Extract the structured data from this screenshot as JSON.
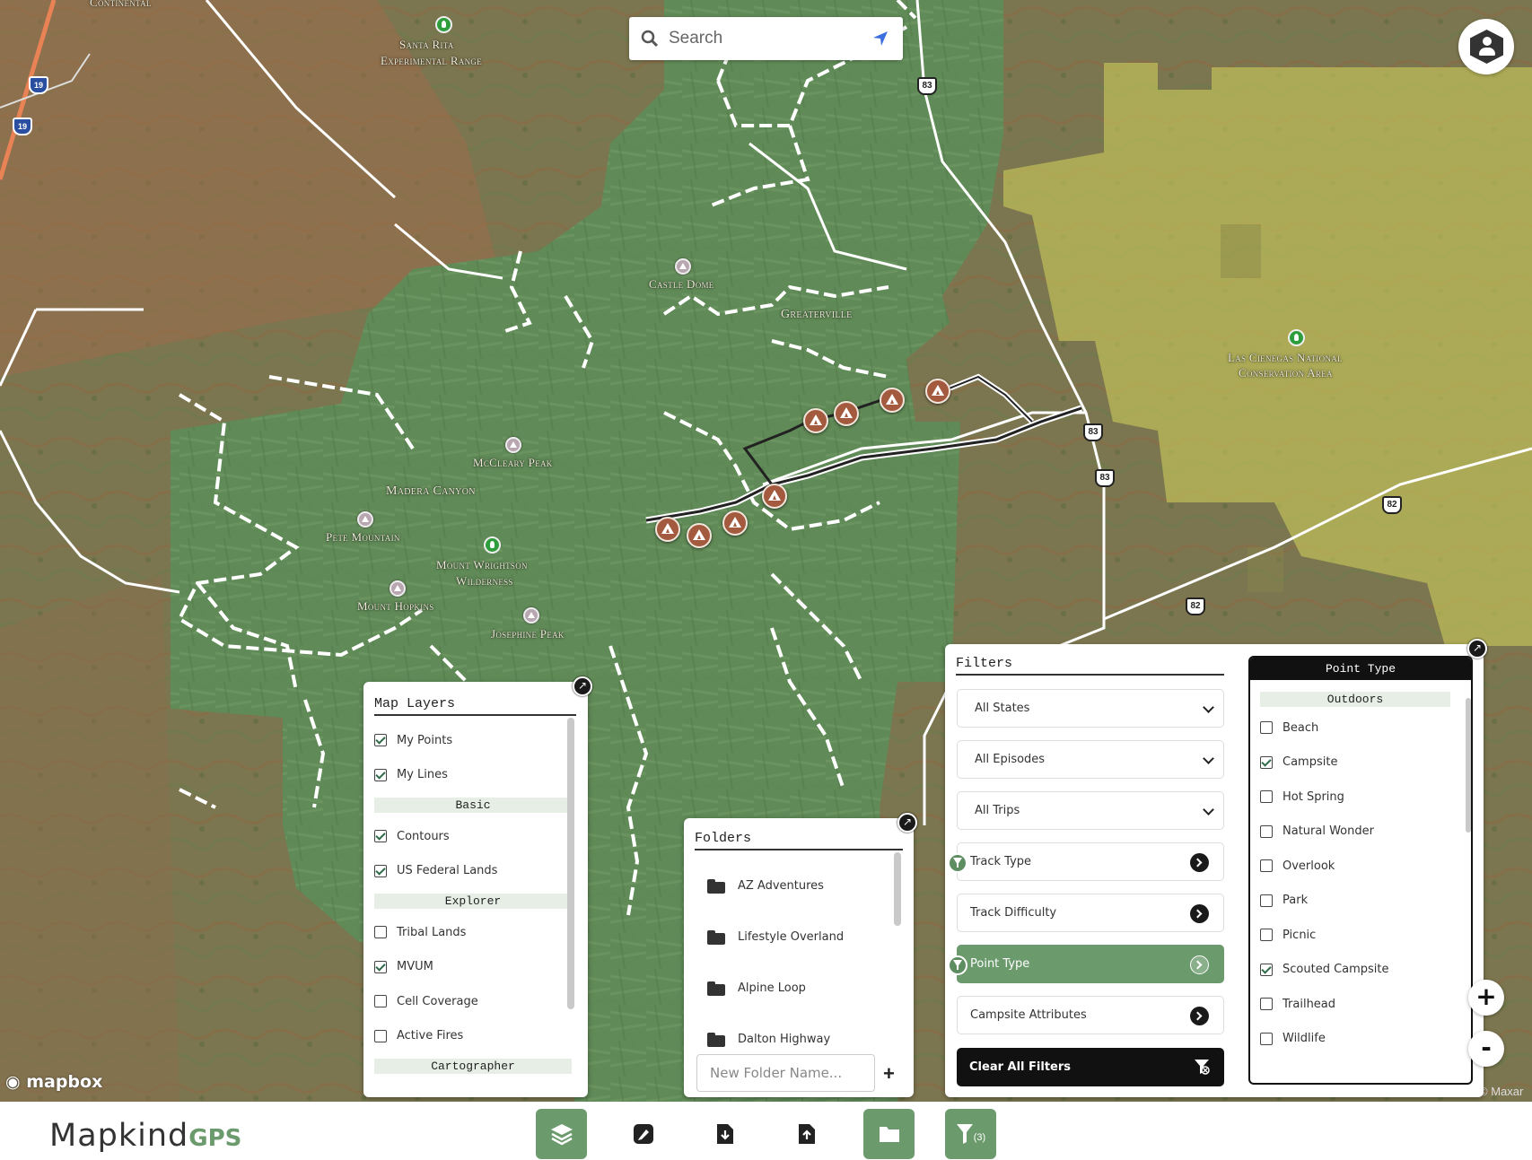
{
  "search": {
    "placeholder": "Search"
  },
  "map": {
    "labels": {
      "continental": "Continental",
      "santa_rita_1": "Santa Rita",
      "santa_rita_2": "Experimental Range",
      "castle_dome": "Castle Dome",
      "greaterville": "Greaterville",
      "mccleary_peak": "McCleary Peak",
      "madera_canyon": "Madera Canyon",
      "pete_mountain": "Pete Mountain",
      "mount_wrightson_1": "Mount Wrightson",
      "mount_wrightson_2": "Wilderness",
      "mount_hopkins": "Mount Hopkins",
      "josephine_peak": "Josephine Peak",
      "las_cienegas_1": "Las Cienegas National",
      "las_cienegas_2": "Conservation Area"
    },
    "route_shields": {
      "r83a": "83",
      "r83b": "83",
      "r83c": "83",
      "r82a": "82",
      "r82b": "82",
      "i19a": "19",
      "i19b": "19"
    },
    "attribution_logo": "mapbox",
    "attribution_maxar": "© Maxar"
  },
  "map_layers": {
    "title": "Map Layers",
    "items": [
      {
        "type": "check",
        "label": "My Points",
        "checked": true
      },
      {
        "type": "check",
        "label": "My Lines",
        "checked": true
      },
      {
        "type": "section",
        "label": "Basic"
      },
      {
        "type": "check",
        "label": "Contours",
        "checked": true
      },
      {
        "type": "check",
        "label": "US Federal Lands",
        "checked": true
      },
      {
        "type": "section",
        "label": "Explorer"
      },
      {
        "type": "check",
        "label": "Tribal Lands",
        "checked": false
      },
      {
        "type": "check",
        "label": "MVUM",
        "checked": true
      },
      {
        "type": "check",
        "label": "Cell Coverage",
        "checked": false
      },
      {
        "type": "check",
        "label": "Active Fires",
        "checked": false
      },
      {
        "type": "section",
        "label": "Cartographer"
      }
    ]
  },
  "folders": {
    "title": "Folders",
    "items": [
      "AZ Adventures",
      "Lifestyle Overland",
      "Alpine Loop",
      "Dalton Highway"
    ],
    "new_placeholder": "New Folder Name...",
    "add_label": "+"
  },
  "filters": {
    "title": "Filters",
    "selects": [
      "All States",
      "All Episodes",
      "All Trips"
    ],
    "nav": [
      {
        "label": "Track Type",
        "badge": true,
        "active": false
      },
      {
        "label": "Track Difficulty",
        "badge": false,
        "active": false
      },
      {
        "label": "Point Type",
        "badge": true,
        "active": true
      },
      {
        "label": "Campsite Attributes",
        "badge": false,
        "active": false
      }
    ],
    "clear_label": "Clear All Filters"
  },
  "point_type": {
    "title": "Point Type",
    "section": "Outdoors",
    "items": [
      {
        "label": "Beach",
        "checked": false
      },
      {
        "label": "Campsite",
        "checked": true
      },
      {
        "label": "Hot Spring",
        "checked": false
      },
      {
        "label": "Natural Wonder",
        "checked": false
      },
      {
        "label": "Overlook",
        "checked": false
      },
      {
        "label": "Park",
        "checked": false
      },
      {
        "label": "Picnic",
        "checked": false
      },
      {
        "label": "Scouted Campsite",
        "checked": true
      },
      {
        "label": "Trailhead",
        "checked": false
      },
      {
        "label": "Wildlife",
        "checked": false
      }
    ]
  },
  "zoom": {
    "in": "+",
    "out": "-"
  },
  "brand": {
    "name": "Mapkind",
    "suffix": "GPS"
  },
  "toolbar": {
    "buttons": [
      {
        "name": "layers",
        "active": true
      },
      {
        "name": "draw",
        "active": false
      },
      {
        "name": "import",
        "active": false
      },
      {
        "name": "export",
        "active": false
      },
      {
        "name": "folders",
        "active": true
      },
      {
        "name": "filters",
        "active": true,
        "badge": "(3)"
      }
    ]
  },
  "colors": {
    "accent": "#6b9a6d",
    "dark": "#111111",
    "forest": "#5d8a5a",
    "blm": "#c9c95a"
  }
}
